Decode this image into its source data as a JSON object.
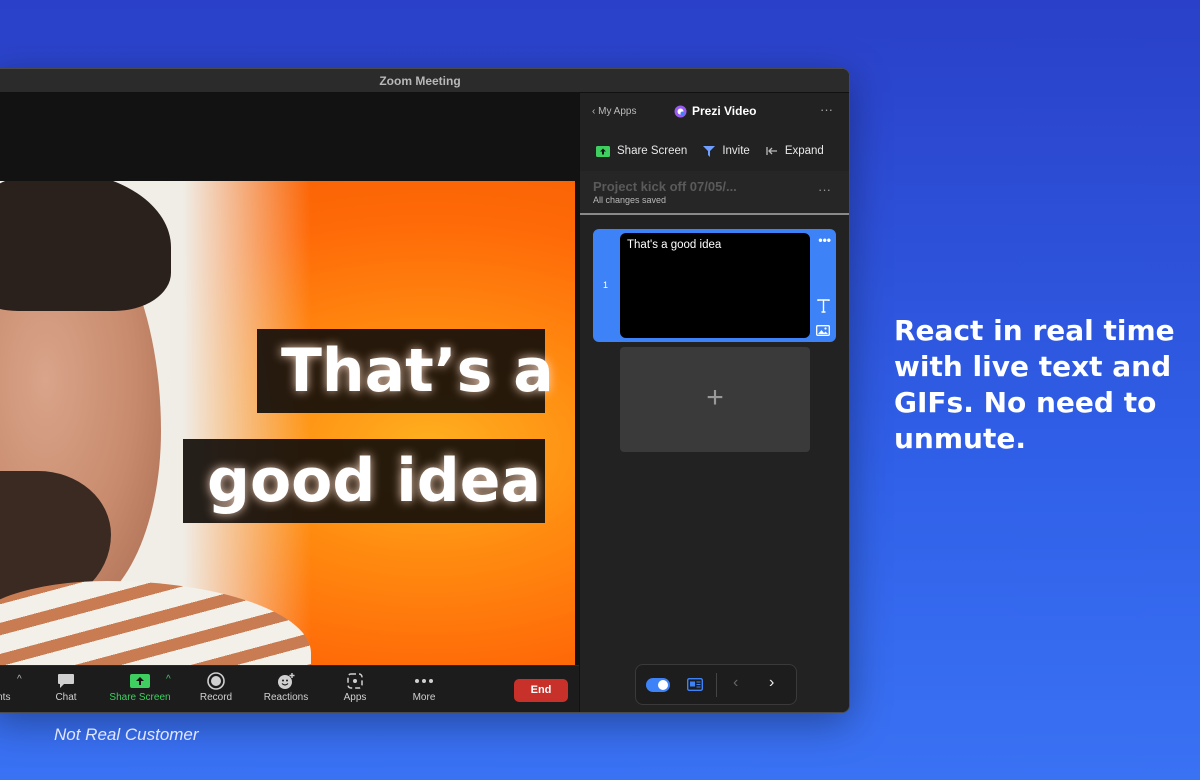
{
  "window": {
    "title": "Zoom Meeting"
  },
  "video": {
    "caption_line1": "That’s a",
    "caption_line2": "good idea"
  },
  "toolbar": {
    "participants_label": "ants",
    "chat_label": "Chat",
    "share_label": "Share Screen",
    "record_label": "Record",
    "reactions_label": "Reactions",
    "apps_label": "Apps",
    "more_label": "More",
    "end_label": "End"
  },
  "panel": {
    "back_label": "My Apps",
    "title": "Prezi Video",
    "actions": {
      "share": "Share Screen",
      "invite": "Invite",
      "expand": "Expand"
    },
    "project": {
      "name": "Project kick off 07/05/...",
      "status": "All changes saved"
    },
    "slides": [
      {
        "number": "1",
        "text": "That's a good idea"
      }
    ],
    "add_label": "+"
  },
  "marketing": {
    "headline": "React in real time with live text and GIFs. No need to unmute.",
    "footnote": "Not Real Customer"
  },
  "colors": {
    "accent": "#3d82f7",
    "end": "#c8302a",
    "share_green": "#3ecf60"
  }
}
